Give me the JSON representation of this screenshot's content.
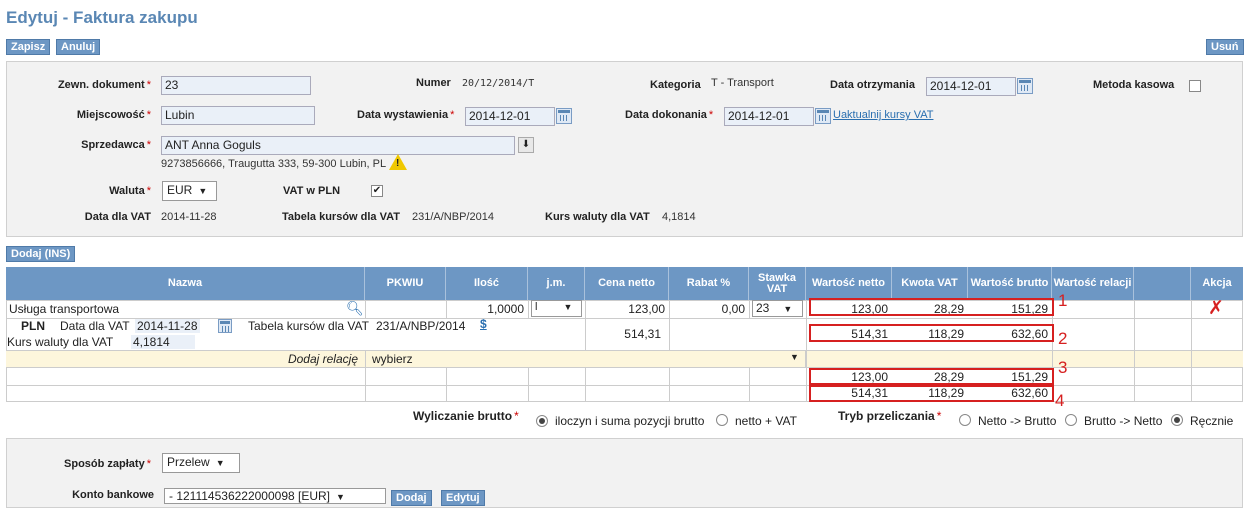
{
  "page": {
    "title": "Edytuj - Faktura zakupu"
  },
  "toolbar": {
    "save": "Zapisz",
    "cancel": "Anuluj",
    "delete": "Usuń"
  },
  "header": {
    "ext_doc_label": "Zewn. dokument",
    "ext_doc_value": "23",
    "number_label": "Numer",
    "number_value": "20/12/2014/T",
    "category_label": "Kategoria",
    "category_value": "T - Transport",
    "received_label": "Data otrzymania",
    "received_value": "2014-12-01",
    "cash_method_label": "Metoda kasowa",
    "city_label": "Miejscowość",
    "city_value": "Lubin",
    "issue_label": "Data wystawienia",
    "issue_value": "2014-12-01",
    "done_label": "Data dokonania",
    "done_value": "2014-12-01",
    "update_rates_link": "Uaktualnij kursy VAT",
    "seller_label": "Sprzedawca",
    "seller_value": "ANT Anna Goguls",
    "seller_address": "9273856666, Traugutta 333, 59-300 Lubin, PL",
    "currency_label": "Waluta",
    "currency_value": "EUR",
    "vat_pln_label": "VAT w PLN",
    "vat_pln_check": "✔",
    "vat_date_label": "Data dla VAT",
    "vat_date_value": "2014-11-28",
    "rate_table_label": "Tabela kursów dla VAT",
    "rate_table_value": "231/A/NBP/2014",
    "rate_label": "Kurs waluty dla VAT",
    "rate_value": "4,1814",
    "required_mark": "*"
  },
  "add_button": "Dodaj (INS)",
  "table": {
    "columns": [
      "Nazwa",
      "PKWIU",
      "Ilość",
      "j.m.",
      "Cena netto",
      "Rabat %",
      "Stawka VAT",
      "Wartość netto",
      "Kwota VAT",
      "Wartość brutto",
      "Wartość relacji",
      "",
      "Akcja"
    ],
    "row": {
      "name": "Usługa transportowa",
      "qty": "1,0000",
      "unit": "l",
      "price": "123,00",
      "discount": "0,00",
      "vat_rate": "23",
      "net": "123,00",
      "vat": "28,29",
      "gross": "151,29"
    },
    "pln_row": {
      "currency": "PLN",
      "vat_date_label": "Data dla VAT",
      "vat_date": "2014-11-28",
      "table_label": "Tabela kursów dla VAT",
      "table_value": "231/A/NBP/2014",
      "dollar": "$",
      "rate_label": "Kurs waluty dla VAT",
      "rate_value": "4,1814",
      "price": "514,31",
      "net": "514,31",
      "vat": "118,29",
      "gross": "632,60"
    },
    "relation_row": {
      "label": "Dodaj relację",
      "select": "wybierz"
    },
    "sum_eur": {
      "net": "123,00",
      "vat": "28,29",
      "gross": "151,29"
    },
    "sum_pln": {
      "net": "514,31",
      "vat": "118,29",
      "gross": "632,60"
    },
    "delete_icon": "✗"
  },
  "annotations": [
    "1",
    "2",
    "3",
    "4"
  ],
  "gross_calc": {
    "label": "Wyliczanie brutto",
    "opt1": "iloczyn i suma pozycji brutto",
    "opt2": "netto + VAT",
    "mode_label": "Tryb przeliczania",
    "mode1": "Netto -> Brutto",
    "mode2": "Brutto -> Netto",
    "mode3": "Ręcznie"
  },
  "payment": {
    "method_label": "Sposób zapłaty",
    "method_value": "Przelew",
    "account_label": "Konto bankowe",
    "account_value": "- 121114536222000098 [EUR]",
    "add": "Dodaj",
    "edit": "Edytuj"
  },
  "colors": {
    "accent": "#6d97c4",
    "highlight": "#d62020",
    "relation_bg": "#fdf6dc"
  }
}
